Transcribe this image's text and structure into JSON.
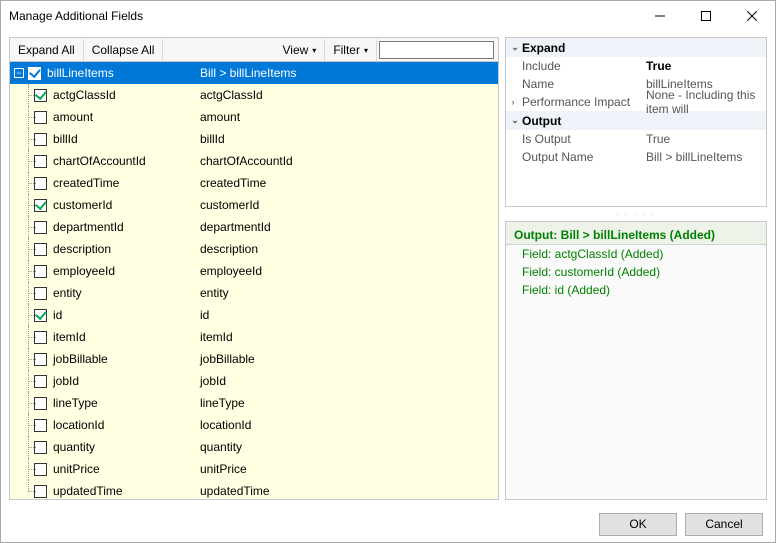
{
  "window": {
    "title": "Manage Additional Fields"
  },
  "toolbar": {
    "expand_all": "Expand All",
    "collapse_all": "Collapse All",
    "view": "View",
    "filter": "Filter",
    "filter_value": ""
  },
  "tree": {
    "root": {
      "name": "billLineItems",
      "path": "Bill > billLineItems",
      "checked": true
    },
    "children": [
      {
        "name": "actgClassId",
        "path": "actgClassId",
        "checked": true
      },
      {
        "name": "amount",
        "path": "amount",
        "checked": false
      },
      {
        "name": "billId",
        "path": "billId",
        "checked": false
      },
      {
        "name": "chartOfAccountId",
        "path": "chartOfAccountId",
        "checked": false
      },
      {
        "name": "createdTime",
        "path": "createdTime",
        "checked": false
      },
      {
        "name": "customerId",
        "path": "customerId",
        "checked": true
      },
      {
        "name": "departmentId",
        "path": "departmentId",
        "checked": false
      },
      {
        "name": "description",
        "path": "description",
        "checked": false
      },
      {
        "name": "employeeId",
        "path": "employeeId",
        "checked": false
      },
      {
        "name": "entity",
        "path": "entity",
        "checked": false
      },
      {
        "name": "id",
        "path": "id",
        "checked": true
      },
      {
        "name": "itemId",
        "path": "itemId",
        "checked": false
      },
      {
        "name": "jobBillable",
        "path": "jobBillable",
        "checked": false
      },
      {
        "name": "jobId",
        "path": "jobId",
        "checked": false
      },
      {
        "name": "lineType",
        "path": "lineType",
        "checked": false
      },
      {
        "name": "locationId",
        "path": "locationId",
        "checked": false
      },
      {
        "name": "quantity",
        "path": "quantity",
        "checked": false
      },
      {
        "name": "unitPrice",
        "path": "unitPrice",
        "checked": false
      },
      {
        "name": "updatedTime",
        "path": "updatedTime",
        "checked": false
      }
    ]
  },
  "props": {
    "cat_expand": "Expand",
    "include_label": "Include",
    "include_value": "True",
    "name_label": "Name",
    "name_value": "billLineItems",
    "perf_label": "Performance Impact",
    "perf_value": "None - Including this item will",
    "cat_output": "Output",
    "isoutput_label": "Is Output",
    "isoutput_value": "True",
    "outputname_label": "Output Name",
    "outputname_value": "Bill > billLineItems"
  },
  "output": {
    "heading": "Output: Bill > billLineItems (Added)",
    "items": [
      "Field: actgClassId (Added)",
      "Field: customerId (Added)",
      "Field: id (Added)"
    ]
  },
  "footer": {
    "ok": "OK",
    "cancel": "Cancel"
  }
}
